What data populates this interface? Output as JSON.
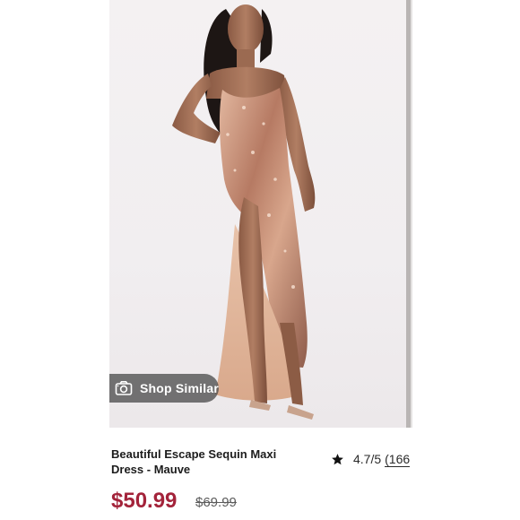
{
  "product": {
    "image_alt": "Model wearing rose gold sequin maxi dress",
    "shop_similar_label": "Shop Similar",
    "shop_similar_icon": "camera-icon",
    "title": "Beautiful Escape Sequin Maxi Dress - Mauve",
    "rating_icon": "star-icon",
    "rating": "4.7/5",
    "review_count_prefix": "(166",
    "price": "$50.99",
    "original_price": "$69.99",
    "colors": {
      "price": "#a3233a",
      "sale_strike": "#5b5b5b",
      "dress": "#c9957c",
      "background": "#f2eff1"
    }
  }
}
